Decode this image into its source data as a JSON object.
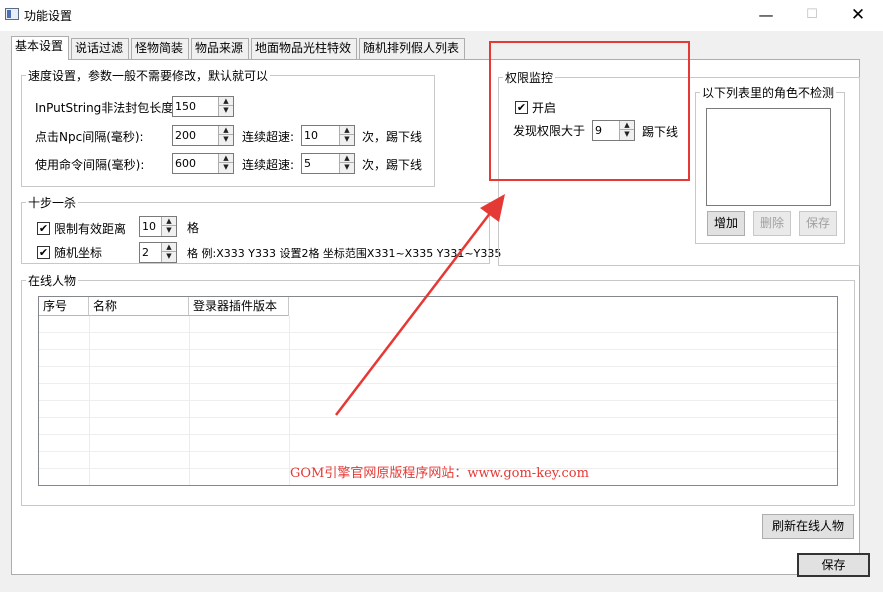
{
  "window": {
    "title": "功能设置",
    "minimize": "—",
    "maximize": "☐",
    "close": "✕"
  },
  "tabs": [
    "基本设置",
    "说话过滤",
    "怪物简装",
    "物品来源",
    "地面物品光柱特效",
    "随机排列假人列表"
  ],
  "speed": {
    "legend": "速度设置，参数一般不需要修改，默认就可以",
    "inputstring_label": "InPutString非法封包长度:",
    "inputstring_value": "150",
    "npc_label": "点击Npc间隔(毫秒):",
    "npc_value": "200",
    "npc_overspeed_label": "连续超速:",
    "npc_overspeed_value": "10",
    "npc_kick_label": "次，踢下线",
    "cmd_label": "使用命令间隔(毫秒):",
    "cmd_value": "600",
    "cmd_overspeed_label": "连续超速:",
    "cmd_overspeed_value": "5",
    "cmd_kick_label": "次，踢下线"
  },
  "tenstep": {
    "legend": "十步一杀",
    "limit_checked": true,
    "limit_label": "限制有效距离",
    "limit_value": "10",
    "limit_unit": "格",
    "random_checked": true,
    "random_label": "随机坐标",
    "random_value": "2",
    "random_desc": "格 例:X333 Y333 设置2格 坐标范围X331~X335 Y331~Y335"
  },
  "perm": {
    "legend": "权限监控",
    "enable_checked": true,
    "enable_label": "开启",
    "threshold_label": "发现权限大于",
    "threshold_value": "9",
    "threshold_suffix": "踢下线"
  },
  "exempt": {
    "legend": "以下列表里的角色不检测",
    "add_label": "增加",
    "delete_label": "删除",
    "save_label": "保存"
  },
  "online": {
    "legend": "在线人物",
    "columns": [
      "序号",
      "名称",
      "登录器插件版本"
    ],
    "refresh_label": "刷新在线人物"
  },
  "save_label": "保存",
  "watermark": "GOM引擎官网原版程序网站：www.gom-key.com",
  "colors": {
    "annotation": "#e53935",
    "panel": "#f0f0f0"
  }
}
